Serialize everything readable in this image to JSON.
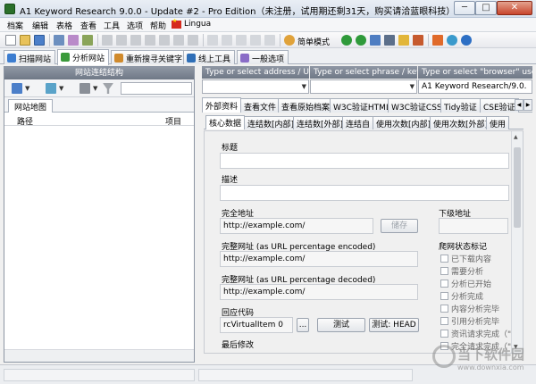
{
  "window": {
    "title": "A1 Keyword Research 9.0.0 - Update #2 - Pro Edition（未注册，试用期还剩31天，购买请洽蓝眼科技）- 新专案",
    "min": "─",
    "max": "□",
    "close": "✕"
  },
  "menu": {
    "items": [
      "档案",
      "编辑",
      "表格",
      "查看",
      "工具",
      "选项",
      "帮助"
    ],
    "lingua": "Lingua"
  },
  "toolbar": {
    "simple_mode": "简单模式"
  },
  "main_tabs": [
    {
      "label": "扫描网站",
      "color": "#3c7dd0"
    },
    {
      "label": "分析网站",
      "color": "#3b9a3b"
    },
    {
      "label": "重新搜寻关键字",
      "color": "#d08a2c"
    },
    {
      "label": "线上工具",
      "color": "#2f6fb7"
    },
    {
      "label": "一般选项",
      "color": "#8a6cc7"
    }
  ],
  "left_panel": {
    "header": "网站连结结构",
    "subtab": "网站地图",
    "col_path": "路径",
    "col_items": "项目"
  },
  "address": {
    "placeholder_url": "Type or select address / URL",
    "placeholder_phrase": "Type or select phrase / key...",
    "placeholder_browser": "Type or select \"browser\" use...",
    "browser_value": "A1 Keyword Research/9.0."
  },
  "tabs_row1": [
    "外部资料",
    "查看文件",
    "查看原始档案",
    "W3C验证HTML",
    "W3C验证CSS",
    "Tidy验证",
    "CSE验证"
  ],
  "tabs_row2": [
    "核心数据",
    "连结数[内部]",
    "连结数[外部]",
    "连结自",
    "使用次数[内部]",
    "使用次数[外部]",
    "使用"
  ],
  "core": {
    "title_label": "标题",
    "desc_label": "描述",
    "full_url_label": "完全地址",
    "full_url_value": "http://example.com/",
    "save_button": "储存",
    "lower_url_label": "下级地址",
    "encoded_label": "完整网址 (as URL percentage encoded)",
    "encoded_value": "http://example.com/",
    "decoded_label": "完整网址 (as URL percentage decoded)",
    "decoded_value": "http://example.com/",
    "response_label": "回应代码",
    "response_value": "rcVirtualItem 0",
    "ellipsis_button": "...",
    "test_button": "测试",
    "test_head_button": "测试: HEAD",
    "last_modified_label": "最后修改",
    "crawl_flags_label": "爬网状态标记",
    "flags": [
      "已下载内容",
      "需要分析",
      "分析已开始",
      "分析完成",
      "内容分析完毕",
      "引用分析完毕",
      "资讯请求完成（\"hea",
      "完全请求完成（\"ge"
    ]
  },
  "watermark": {
    "main": "当下软件园",
    "sub": "www.downxia.com"
  }
}
